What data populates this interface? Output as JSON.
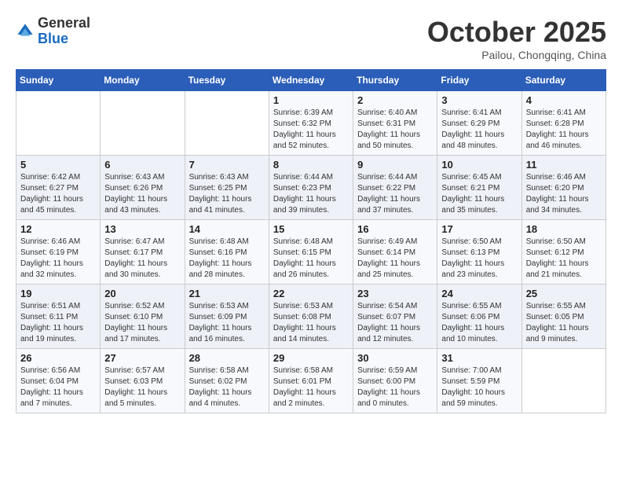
{
  "header": {
    "logo_general": "General",
    "logo_blue": "Blue",
    "month_title": "October 2025",
    "subtitle": "Pailou, Chongqing, China"
  },
  "weekdays": [
    "Sunday",
    "Monday",
    "Tuesday",
    "Wednesday",
    "Thursday",
    "Friday",
    "Saturday"
  ],
  "weeks": [
    [
      {
        "day": "",
        "info": ""
      },
      {
        "day": "",
        "info": ""
      },
      {
        "day": "",
        "info": ""
      },
      {
        "day": "1",
        "info": "Sunrise: 6:39 AM\nSunset: 6:32 PM\nDaylight: 11 hours\nand 52 minutes."
      },
      {
        "day": "2",
        "info": "Sunrise: 6:40 AM\nSunset: 6:31 PM\nDaylight: 11 hours\nand 50 minutes."
      },
      {
        "day": "3",
        "info": "Sunrise: 6:41 AM\nSunset: 6:29 PM\nDaylight: 11 hours\nand 48 minutes."
      },
      {
        "day": "4",
        "info": "Sunrise: 6:41 AM\nSunset: 6:28 PM\nDaylight: 11 hours\nand 46 minutes."
      }
    ],
    [
      {
        "day": "5",
        "info": "Sunrise: 6:42 AM\nSunset: 6:27 PM\nDaylight: 11 hours\nand 45 minutes."
      },
      {
        "day": "6",
        "info": "Sunrise: 6:43 AM\nSunset: 6:26 PM\nDaylight: 11 hours\nand 43 minutes."
      },
      {
        "day": "7",
        "info": "Sunrise: 6:43 AM\nSunset: 6:25 PM\nDaylight: 11 hours\nand 41 minutes."
      },
      {
        "day": "8",
        "info": "Sunrise: 6:44 AM\nSunset: 6:23 PM\nDaylight: 11 hours\nand 39 minutes."
      },
      {
        "day": "9",
        "info": "Sunrise: 6:44 AM\nSunset: 6:22 PM\nDaylight: 11 hours\nand 37 minutes."
      },
      {
        "day": "10",
        "info": "Sunrise: 6:45 AM\nSunset: 6:21 PM\nDaylight: 11 hours\nand 35 minutes."
      },
      {
        "day": "11",
        "info": "Sunrise: 6:46 AM\nSunset: 6:20 PM\nDaylight: 11 hours\nand 34 minutes."
      }
    ],
    [
      {
        "day": "12",
        "info": "Sunrise: 6:46 AM\nSunset: 6:19 PM\nDaylight: 11 hours\nand 32 minutes."
      },
      {
        "day": "13",
        "info": "Sunrise: 6:47 AM\nSunset: 6:17 PM\nDaylight: 11 hours\nand 30 minutes."
      },
      {
        "day": "14",
        "info": "Sunrise: 6:48 AM\nSunset: 6:16 PM\nDaylight: 11 hours\nand 28 minutes."
      },
      {
        "day": "15",
        "info": "Sunrise: 6:48 AM\nSunset: 6:15 PM\nDaylight: 11 hours\nand 26 minutes."
      },
      {
        "day": "16",
        "info": "Sunrise: 6:49 AM\nSunset: 6:14 PM\nDaylight: 11 hours\nand 25 minutes."
      },
      {
        "day": "17",
        "info": "Sunrise: 6:50 AM\nSunset: 6:13 PM\nDaylight: 11 hours\nand 23 minutes."
      },
      {
        "day": "18",
        "info": "Sunrise: 6:50 AM\nSunset: 6:12 PM\nDaylight: 11 hours\nand 21 minutes."
      }
    ],
    [
      {
        "day": "19",
        "info": "Sunrise: 6:51 AM\nSunset: 6:11 PM\nDaylight: 11 hours\nand 19 minutes."
      },
      {
        "day": "20",
        "info": "Sunrise: 6:52 AM\nSunset: 6:10 PM\nDaylight: 11 hours\nand 17 minutes."
      },
      {
        "day": "21",
        "info": "Sunrise: 6:53 AM\nSunset: 6:09 PM\nDaylight: 11 hours\nand 16 minutes."
      },
      {
        "day": "22",
        "info": "Sunrise: 6:53 AM\nSunset: 6:08 PM\nDaylight: 11 hours\nand 14 minutes."
      },
      {
        "day": "23",
        "info": "Sunrise: 6:54 AM\nSunset: 6:07 PM\nDaylight: 11 hours\nand 12 minutes."
      },
      {
        "day": "24",
        "info": "Sunrise: 6:55 AM\nSunset: 6:06 PM\nDaylight: 11 hours\nand 10 minutes."
      },
      {
        "day": "25",
        "info": "Sunrise: 6:55 AM\nSunset: 6:05 PM\nDaylight: 11 hours\nand 9 minutes."
      }
    ],
    [
      {
        "day": "26",
        "info": "Sunrise: 6:56 AM\nSunset: 6:04 PM\nDaylight: 11 hours\nand 7 minutes."
      },
      {
        "day": "27",
        "info": "Sunrise: 6:57 AM\nSunset: 6:03 PM\nDaylight: 11 hours\nand 5 minutes."
      },
      {
        "day": "28",
        "info": "Sunrise: 6:58 AM\nSunset: 6:02 PM\nDaylight: 11 hours\nand 4 minutes."
      },
      {
        "day": "29",
        "info": "Sunrise: 6:58 AM\nSunset: 6:01 PM\nDaylight: 11 hours\nand 2 minutes."
      },
      {
        "day": "30",
        "info": "Sunrise: 6:59 AM\nSunset: 6:00 PM\nDaylight: 11 hours\nand 0 minutes."
      },
      {
        "day": "31",
        "info": "Sunrise: 7:00 AM\nSunset: 5:59 PM\nDaylight: 10 hours\nand 59 minutes."
      },
      {
        "day": "",
        "info": ""
      }
    ]
  ]
}
